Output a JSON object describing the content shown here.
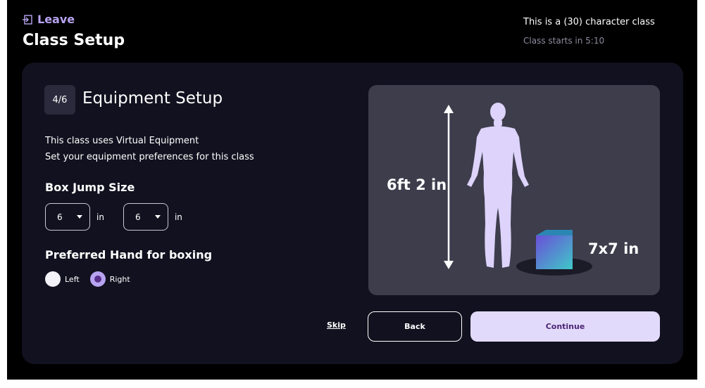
{
  "header": {
    "leave_label": "Leave",
    "page_title": "Class Setup",
    "class_description": "This is a (30) character class",
    "class_starts": "Class starts in 5:10"
  },
  "step": {
    "badge": "4/6",
    "title": "Equipment Setup"
  },
  "description": [
    "This class uses Virtual Equipment",
    "Set your equipment preferences for this class"
  ],
  "box_jump": {
    "heading": "Box Jump Size",
    "selects": [
      {
        "value": "6",
        "unit": "in"
      },
      {
        "value": "6",
        "unit": "in"
      }
    ]
  },
  "hand": {
    "heading": "Preferred Hand for boxing",
    "options": [
      {
        "label": "Left",
        "selected": false
      },
      {
        "label": "Right",
        "selected": true
      }
    ]
  },
  "illustration": {
    "height_label": "6ft 2 in",
    "box_label": "7x7 in"
  },
  "actions": {
    "skip": "Skip",
    "back": "Back",
    "continue": "Continue"
  },
  "colors": {
    "background": "#000000",
    "card": "#12111f",
    "accent": "#b7a4f1",
    "continue_bg": "#e2dafb",
    "continue_text": "#4b2673",
    "illustration_bg": "#3e3d4c",
    "figure": "#ddd3fb"
  },
  "icons": {
    "leave": "exit-door-icon",
    "select_caret": "chevron-down-icon"
  }
}
